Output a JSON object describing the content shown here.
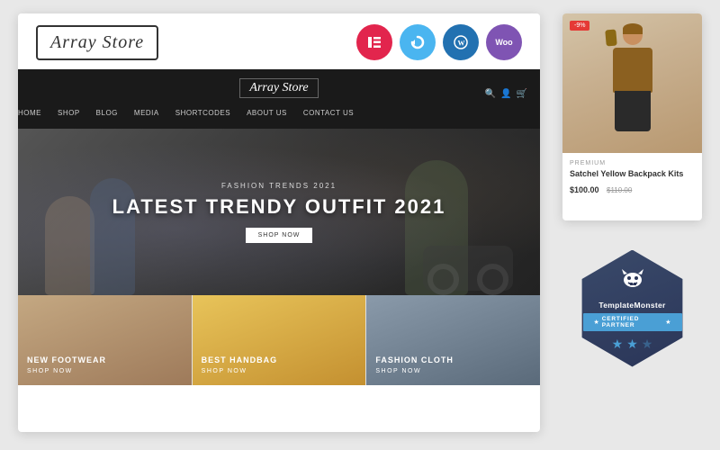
{
  "main_card": {
    "logo": "Array Store",
    "nav": {
      "logo": "Array Store",
      "links": [
        "HOME",
        "SHOP",
        "BLOG",
        "MEDIA",
        "SHORTCODES",
        "ABOUT US",
        "CONTACT US"
      ]
    },
    "hero": {
      "subtitle": "Fashion Trends 2021",
      "title": "LATEST TRENDY OUTFIT 2021",
      "button": "SHOP NOW"
    },
    "categories": [
      {
        "label": "NEW FOOTWEAR",
        "sublabel": "SHOP NOW"
      },
      {
        "label": "BEST HANDBAG",
        "sublabel": "SHOP NOW"
      },
      {
        "label": "FASHION CLOTH",
        "sublabel": "SHOP NOW"
      }
    ]
  },
  "product": {
    "sale_badge": "-9%",
    "label": "PREMIUM",
    "name": "Satchel Yellow Backpack Kits",
    "price": "$100.00",
    "old_price": "$110.00"
  },
  "plugins": [
    {
      "name": "Elementor",
      "letter": "E"
    },
    {
      "name": "Refresh",
      "letter": "↻"
    },
    {
      "name": "WordPress",
      "letter": "W"
    },
    {
      "name": "WooCommerce",
      "letter": "Woo"
    }
  ],
  "template_monster": {
    "icon": "👾",
    "name": "TemplateMönster",
    "certified": "★ CERTIFIED PARTNER ★",
    "stars": [
      "★",
      "★",
      "☆"
    ]
  }
}
